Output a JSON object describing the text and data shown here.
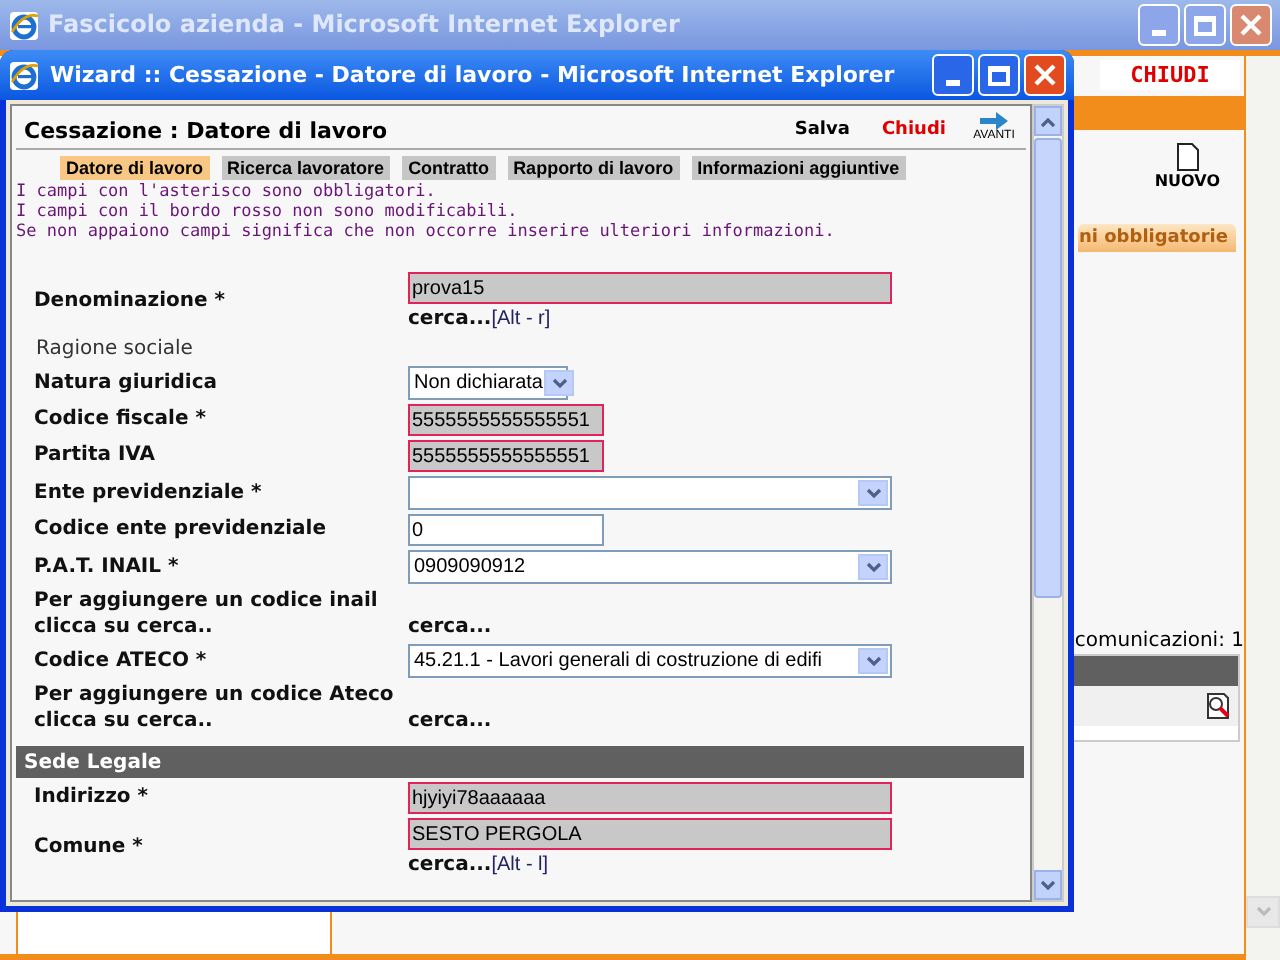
{
  "main_window": {
    "title": "Fascicolo azienda - Microsoft Internet Explorer",
    "close_link": "CHIUDI",
    "new_button": "NUOVO",
    "tab_partial": "ni obbligatorie",
    "count_label": "comunicazioni: 1"
  },
  "wizard": {
    "title": "Wizard :: Cessazione - Datore di lavoro - Microsoft Internet Explorer",
    "heading": "Cessazione : Datore di lavoro",
    "save": "Salva",
    "close": "Chiudi",
    "next": "AVANTI",
    "tabs": [
      {
        "label": "Datore di lavoro",
        "selected": true
      },
      {
        "label": "Ricerca lavoratore",
        "selected": false
      },
      {
        "label": "Contratto",
        "selected": false
      },
      {
        "label": "Rapporto di lavoro",
        "selected": false
      },
      {
        "label": "Informazioni aggiuntive",
        "selected": false
      }
    ],
    "notes": [
      "I campi con l'asterisco sono obbligatori.",
      "I campi con il bordo rosso non sono modificabili.",
      "Se non appaiono campi significa che non occorre inserire ulteriori informazioni."
    ],
    "fields": [
      {
        "kind": "wide_text",
        "label": "Denominazione *",
        "value": "prova15",
        "readonly": true,
        "link": "cerca...",
        "shortcut": "[Alt - r]"
      },
      {
        "kind": "note",
        "label": "Ragione sociale"
      },
      {
        "kind": "select",
        "label": "Natura giuridica",
        "value": "Non dichiarata"
      },
      {
        "kind": "text",
        "label": "Codice fiscale *",
        "value": "5555555555555551",
        "readonly": true
      },
      {
        "kind": "text",
        "label": "Partita IVA",
        "value": "5555555555555551",
        "readonly": true
      },
      {
        "kind": "wide_select",
        "label": "Ente previdenziale *"
      },
      {
        "kind": "text",
        "label": "Codice ente previdenziale",
        "value": "0",
        "readonly": false
      },
      {
        "kind": "wide_select",
        "label": "P.A.T. INAIL *",
        "value": "0909090912"
      },
      {
        "kind": "search",
        "label": "Per aggiungere un codice inail clicca su cerca..",
        "link": "cerca..."
      },
      {
        "kind": "wide_select",
        "label": "Codice ATECO *",
        "value": "45.21.1 - Lavori generali di costruzione di edifi"
      },
      {
        "kind": "search",
        "label": "Per aggiungere un codice Ateco clicca su cerca..",
        "link": "cerca..."
      },
      {
        "kind": "section",
        "label": "Sede Legale"
      },
      {
        "kind": "wide_text",
        "label": "Indirizzo *",
        "value": "hjyiyi78aaaaaa",
        "readonly": true
      },
      {
        "kind": "wide_text",
        "label": "Comune *",
        "value": "SESTO PERGOLA",
        "readonly": true,
        "link": "cerca...",
        "shortcut": "[Alt - l]"
      }
    ]
  }
}
